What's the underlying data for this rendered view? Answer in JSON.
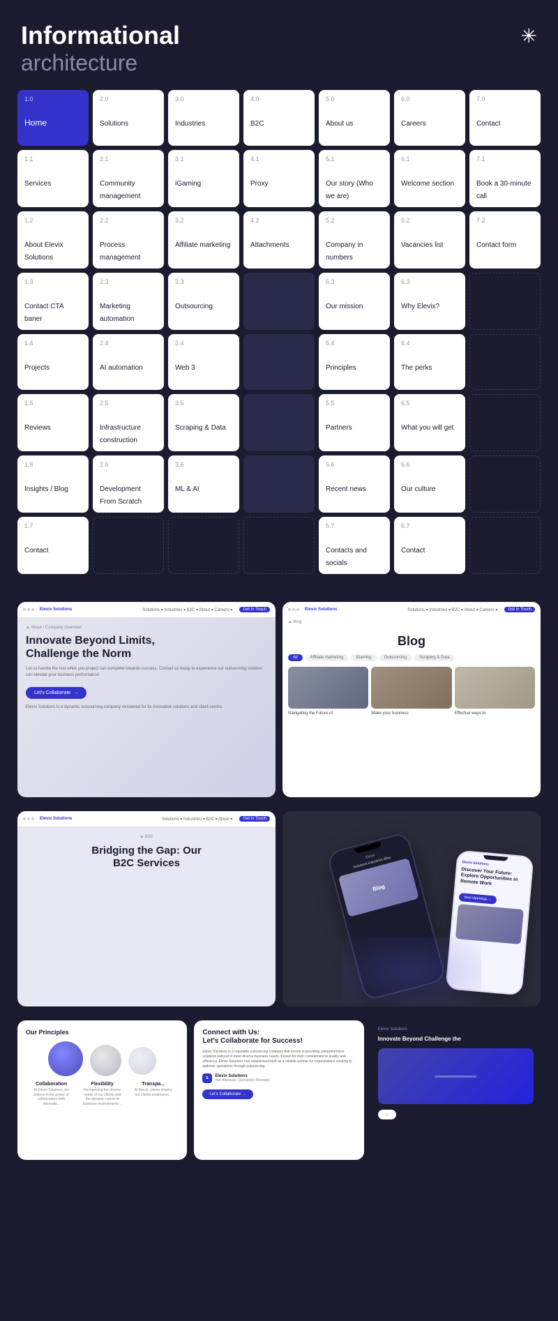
{
  "header": {
    "title_bold": "Informational",
    "title_light": "architecture",
    "asterisk": "✳"
  },
  "grid": {
    "row0": [
      {
        "num": "1.0",
        "label": "Home",
        "type": "home"
      },
      {
        "num": "2.0",
        "label": "Solutions",
        "type": "normal"
      },
      {
        "num": "3.0",
        "label": "Industries",
        "type": "normal"
      },
      {
        "num": "4.0",
        "label": "B2C",
        "type": "normal"
      },
      {
        "num": "5.0",
        "label": "About us",
        "type": "normal"
      },
      {
        "num": "6.0",
        "label": "Careers",
        "type": "normal"
      },
      {
        "num": "7.0",
        "label": "Contact",
        "type": "normal"
      }
    ],
    "row1": [
      {
        "num": "1.1",
        "label": "Services",
        "type": "normal"
      },
      {
        "num": "2.1",
        "label": "Community management",
        "type": "normal"
      },
      {
        "num": "3.1",
        "label": "iGaming",
        "type": "normal"
      },
      {
        "num": "4.1",
        "label": "Proxy",
        "type": "normal"
      },
      {
        "num": "5.1",
        "label": "Our story (Who we are)",
        "type": "normal"
      },
      {
        "num": "6.1",
        "label": "Welcome section",
        "type": "normal"
      },
      {
        "num": "7.1",
        "label": "Book a 30-minute call",
        "type": "normal"
      }
    ],
    "row2": [
      {
        "num": "1.2",
        "label": "About Elevix Solutions",
        "type": "normal"
      },
      {
        "num": "2.2",
        "label": "Process management",
        "type": "normal"
      },
      {
        "num": "3.2",
        "label": "Affiliate marketing",
        "type": "normal"
      },
      {
        "num": "4.2",
        "label": "Attachments",
        "type": "normal"
      },
      {
        "num": "5.2",
        "label": "Company in numbers",
        "type": "normal"
      },
      {
        "num": "6.2",
        "label": "Vacancies list",
        "type": "normal"
      },
      {
        "num": "7.2",
        "label": "Contact form",
        "type": "normal"
      }
    ],
    "row3": [
      {
        "num": "1.3",
        "label": "Contact CTA baner",
        "type": "normal"
      },
      {
        "num": "2.3",
        "label": "Marketing automation",
        "type": "normal"
      },
      {
        "num": "3.3",
        "label": "Outsourcing",
        "type": "normal"
      },
      {
        "num": "",
        "label": "",
        "type": "dark"
      },
      {
        "num": "5.3",
        "label": "Our mission",
        "type": "normal"
      },
      {
        "num": "6.3",
        "label": "Why Elevix?",
        "type": "normal"
      },
      {
        "num": "",
        "label": "",
        "type": "empty"
      }
    ],
    "row4": [
      {
        "num": "1.4",
        "label": "Projects",
        "type": "normal"
      },
      {
        "num": "2.4",
        "label": "AI automation",
        "type": "normal"
      },
      {
        "num": "3.4",
        "label": "Web 3",
        "type": "normal"
      },
      {
        "num": "",
        "label": "",
        "type": "dark"
      },
      {
        "num": "5.4",
        "label": "Principles",
        "type": "normal"
      },
      {
        "num": "6.4",
        "label": "The perks",
        "type": "normal"
      },
      {
        "num": "",
        "label": "",
        "type": "empty"
      }
    ],
    "row5": [
      {
        "num": "1.5",
        "label": "Reviews",
        "type": "normal"
      },
      {
        "num": "2.5",
        "label": "Infrastructure construction",
        "type": "normal"
      },
      {
        "num": "3.5",
        "label": "Scraping & Data",
        "type": "normal"
      },
      {
        "num": "",
        "label": "",
        "type": "dark"
      },
      {
        "num": "5.5",
        "label": "Partners",
        "type": "normal"
      },
      {
        "num": "6.5",
        "label": "What you will get",
        "type": "normal"
      },
      {
        "num": "",
        "label": "",
        "type": "empty"
      }
    ],
    "row6": [
      {
        "num": "1.6",
        "label": "Insights / Blog",
        "type": "normal"
      },
      {
        "num": "2.6",
        "label": "Development From Scratch",
        "type": "normal"
      },
      {
        "num": "3.6",
        "label": "ML & AI",
        "type": "normal"
      },
      {
        "num": "",
        "label": "",
        "type": "dark"
      },
      {
        "num": "5.6",
        "label": "Recent news",
        "type": "normal"
      },
      {
        "num": "6.6",
        "label": "Our culture",
        "type": "normal"
      },
      {
        "num": "",
        "label": "",
        "type": "empty"
      }
    ],
    "row7": [
      {
        "num": "1.7",
        "label": "Contact",
        "type": "normal"
      },
      {
        "num": "",
        "label": "",
        "type": "empty"
      },
      {
        "num": "",
        "label": "",
        "type": "empty"
      },
      {
        "num": "",
        "label": "",
        "type": "empty"
      },
      {
        "num": "5.7",
        "label": "Contacts and socials",
        "type": "normal"
      },
      {
        "num": "6.7",
        "label": "Contact",
        "type": "normal"
      },
      {
        "num": "",
        "label": "",
        "type": "empty"
      }
    ]
  },
  "preview_about": {
    "nav_items": [
      "Solutions ▾",
      "Industries ▾",
      "B2C ▾",
      "About ▾",
      "Careers ▾"
    ],
    "cta_btn": "Get in Touch",
    "breadcrumb": "▲ About / Company Overview",
    "headline_line1": "Innovate Beyond Limits,",
    "headline_line2": "Challenge the Norm",
    "subtext": "Let us handle the rest while you project can complete towards success. Contact us today to experience our outsourcing solution can elevate your business performance.",
    "btn_label": "Let's Collaborate",
    "body_text": "Elevix Solutions is a dynamic outsourcing company renowned for its innovative solutions and client-centric"
  },
  "preview_blog": {
    "breadcrumb": "▲ Blog",
    "title": "Blog",
    "tags": [
      "All",
      "Affiliate marketing",
      "iGaming",
      "Outsourcing",
      "Scraping & Data"
    ],
    "active_tag": "All",
    "captions": [
      "Navigating the Future of",
      "Make your business",
      "Effective ways to"
    ]
  },
  "preview_b2c": {
    "breadcrumb": "▲ B2C",
    "headline_line1": "Bridging the Gap: Our",
    "headline_line2": "B2C Services"
  },
  "preview_phones": {
    "blog_label": "Blog",
    "small_logo": "Elevix Solutions",
    "small_headline": "Discover Your Future: Explore Opportunities in Remote Work",
    "small_btn": "View Openings →"
  },
  "principles": {
    "title": "Our Principles",
    "items": [
      "Collaboration",
      "Flexibility",
      "Transpa..."
    ]
  },
  "connect": {
    "headline_line1": "Connect with Us:",
    "headline_line2": "Let's Collaborate for Success!",
    "body": "Elevix Solutions is a reputable outsourcing company that excels in providing comprehensive solutions tailored to meet diverse business needs. Known for their commitment to quality and efficiency, Elevix Solutions has established itself as a reliable partner for organizations seeking to optimize operations through outsourcing.",
    "logo_text": "E",
    "company": "Elevix Solutions",
    "author": "Ihor Atanasov, Operations Manager",
    "btn_label": "Let's Collaborate →"
  },
  "innovate": {
    "logo": "Elevix Solutions",
    "headline": "Innovate Beyond Challenge the"
  }
}
